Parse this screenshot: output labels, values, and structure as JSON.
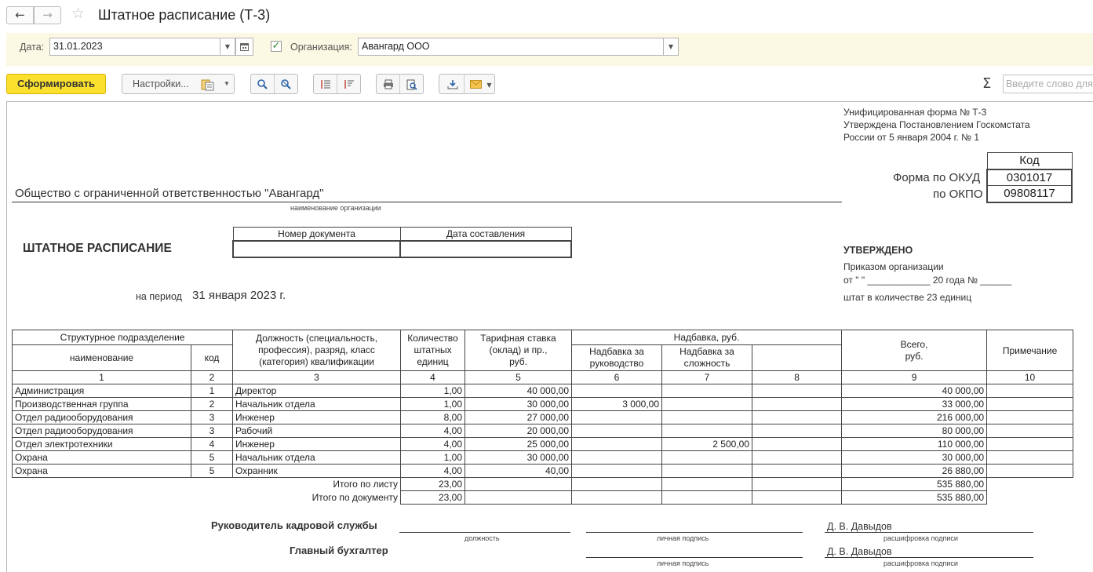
{
  "window": {
    "title": "Штатное расписание (Т-3)"
  },
  "params": {
    "date_label": "Дата:",
    "date_value": "31.01.2023",
    "org_label": "Организация:",
    "org_value": "Авангард ООО",
    "org_checked": true
  },
  "toolbar": {
    "generate_label": "Сформировать",
    "settings_label": "Настройки...",
    "sum_symbol": "Σ",
    "search_placeholder": "Введите слово для поиска"
  },
  "report": {
    "form_header": [
      "Унифицированная форма № Т-3",
      "Утверждена Постановлением Госкомстата",
      "России от 5 января 2004 г. № 1"
    ],
    "code_header": "Код",
    "okud_label": "Форма по ОКУД",
    "okud_value": "0301017",
    "okpo_label": "по ОКПО",
    "okpo_value": "09808117",
    "org_name": "Общество с ограниченной ответственностью \"Авангард\"",
    "org_caption": "наименование организации",
    "doc_title": "ШТАТНОЕ РАСПИСАНИЕ",
    "doc_number_header": "Номер документа",
    "doc_date_header": "Дата составления",
    "period_label": "на период",
    "period_value": "31 января 2023 г.",
    "approved_title": "УТВЕРЖДЕНО",
    "approved_line1": "Приказом организации",
    "approved_line2": "от \"       \" ____________ 20      года № ______",
    "approved_line3": "штат в количестве 23 единиц",
    "table": {
      "h_division": "Структурное  подразделение",
      "h_name": "наименование",
      "h_code": "код",
      "h_position": [
        "Должность (специальность,",
        "профессия), разряд, класс",
        "(категория) квалификации"
      ],
      "h_count": [
        "Количество",
        "штатных",
        "единиц"
      ],
      "h_rate": [
        "Тарифная ставка",
        "(оклад) и пр.,",
        "руб."
      ],
      "h_bonus": "Надбавка, руб.",
      "h_bonus_mgmt": [
        "Надбавка за",
        "руководство"
      ],
      "h_bonus_complex": [
        "Надбавка за",
        "сложность"
      ],
      "h_total": [
        "Всего,",
        "руб."
      ],
      "h_note": "Примечание",
      "col_numbers": [
        "1",
        "2",
        "3",
        "4",
        "5",
        "6",
        "7",
        "8",
        "9",
        "10"
      ],
      "rows": [
        {
          "name": "Администрация",
          "code": "1",
          "position": "Директор",
          "count": "1,00",
          "rate": "40 000,00",
          "bonus_mgmt": "",
          "bonus_complex": "",
          "extra": "",
          "total": "40 000,00",
          "note": ""
        },
        {
          "name": "Производственная группа",
          "code": "2",
          "position": "Начальник отдела",
          "count": "1,00",
          "rate": "30 000,00",
          "bonus_mgmt": "3 000,00",
          "bonus_complex": "",
          "extra": "",
          "total": "33 000,00",
          "note": ""
        },
        {
          "name": "Отдел радиооборудования",
          "code": "3",
          "position": "Инженер",
          "count": "8,00",
          "rate": "27 000,00",
          "bonus_mgmt": "",
          "bonus_complex": "",
          "extra": "",
          "total": "216 000,00",
          "note": ""
        },
        {
          "name": "Отдел радиооборудования",
          "code": "3",
          "position": "Рабочий",
          "count": "4,00",
          "rate": "20 000,00",
          "bonus_mgmt": "",
          "bonus_complex": "",
          "extra": "",
          "total": "80 000,00",
          "note": ""
        },
        {
          "name": "Отдел электротехники",
          "code": "4",
          "position": "Инженер",
          "count": "4,00",
          "rate": "25 000,00",
          "bonus_mgmt": "",
          "bonus_complex": "2 500,00",
          "extra": "",
          "total": "110 000,00",
          "note": ""
        },
        {
          "name": "Охрана",
          "code": "5",
          "position": "Начальник отдела",
          "count": "1,00",
          "rate": "30 000,00",
          "bonus_mgmt": "",
          "bonus_complex": "",
          "extra": "",
          "total": "30 000,00",
          "note": ""
        },
        {
          "name": "Охрана",
          "code": "5",
          "position": "Охранник",
          "count": "4,00",
          "rate": "40,00",
          "bonus_mgmt": "",
          "bonus_complex": "",
          "extra": "",
          "total": "26 880,00",
          "note": ""
        }
      ],
      "sheet_total_label": "Итого по листу",
      "sheet_total_count": "23,00",
      "sheet_total_sum": "535 880,00",
      "doc_total_label": "Итого по документу",
      "doc_total_count": "23,00",
      "doc_total_sum": "535 880,00"
    },
    "signatures": {
      "hr_head_label": "Руководитель кадровой службы",
      "chief_accountant_label": "Главный бухгалтер",
      "position_caption": "должность",
      "signature_caption": "личная подпись",
      "decoding_caption": "расшифровка  подписи",
      "hr_head_name": "Д. В. Давыдов",
      "chief_accountant_name": "Д. В. Давыдов"
    }
  }
}
